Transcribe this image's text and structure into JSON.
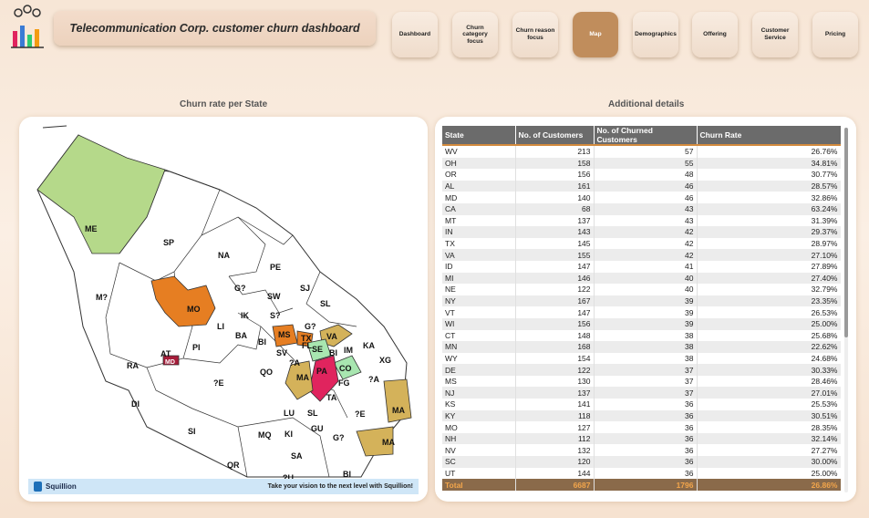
{
  "header": {
    "title": "Telecommunication Corp. customer churn dashboard"
  },
  "nav": [
    {
      "label": "Dashboard",
      "active": false
    },
    {
      "label": "Churn category focus",
      "active": false
    },
    {
      "label": "Churn reason focus",
      "active": false
    },
    {
      "label": "Map",
      "active": true
    },
    {
      "label": "Demographics",
      "active": false
    },
    {
      "label": "Offering",
      "active": false
    },
    {
      "label": "Customer Service",
      "active": false
    },
    {
      "label": "Pricing",
      "active": false
    }
  ],
  "map": {
    "section_title": "Churn rate per State",
    "regions": [
      "ME",
      "SP",
      "NA",
      "PE",
      "M?",
      "SJ",
      "G?",
      "SW",
      "MO",
      "SL",
      "IK",
      "S?",
      "LI",
      "G?",
      "BA",
      "MS",
      "TX",
      "VA",
      "BI",
      "IM",
      "AT",
      "PI",
      "FL",
      "SE",
      "BI",
      "KA",
      "SV",
      "?A",
      "MD",
      "RA",
      "QO",
      "CO",
      "XG",
      "MA",
      "PA",
      "FG",
      "?A",
      "?E",
      "DI",
      "TA",
      "LU",
      "SL",
      "MA",
      "?E",
      "SI",
      "GU",
      "MQ",
      "KI",
      "G?",
      "MA",
      "SA",
      "QR",
      "?U",
      "BI"
    ],
    "footer_brand": "Squillion",
    "footer_tagline": "Take your vision to the next level with Squillion!"
  },
  "table": {
    "section_title": "Additional details",
    "columns": [
      "State",
      "No. of Customers",
      "No. of Churned Customers",
      "Churn Rate"
    ],
    "rows": [
      [
        "WV",
        "213",
        "57",
        "26.76%"
      ],
      [
        "OH",
        "158",
        "55",
        "34.81%"
      ],
      [
        "OR",
        "156",
        "48",
        "30.77%"
      ],
      [
        "AL",
        "161",
        "46",
        "28.57%"
      ],
      [
        "MD",
        "140",
        "46",
        "32.86%"
      ],
      [
        "CA",
        "68",
        "43",
        "63.24%"
      ],
      [
        "MT",
        "137",
        "43",
        "31.39%"
      ],
      [
        "IN",
        "143",
        "42",
        "29.37%"
      ],
      [
        "TX",
        "145",
        "42",
        "28.97%"
      ],
      [
        "VA",
        "155",
        "42",
        "27.10%"
      ],
      [
        "ID",
        "147",
        "41",
        "27.89%"
      ],
      [
        "MI",
        "146",
        "40",
        "27.40%"
      ],
      [
        "NE",
        "122",
        "40",
        "32.79%"
      ],
      [
        "NY",
        "167",
        "39",
        "23.35%"
      ],
      [
        "VT",
        "147",
        "39",
        "26.53%"
      ],
      [
        "WI",
        "156",
        "39",
        "25.00%"
      ],
      [
        "CT",
        "148",
        "38",
        "25.68%"
      ],
      [
        "MN",
        "168",
        "38",
        "22.62%"
      ],
      [
        "WY",
        "154",
        "38",
        "24.68%"
      ],
      [
        "DE",
        "122",
        "37",
        "30.33%"
      ],
      [
        "MS",
        "130",
        "37",
        "28.46%"
      ],
      [
        "NJ",
        "137",
        "37",
        "27.01%"
      ],
      [
        "KS",
        "141",
        "36",
        "25.53%"
      ],
      [
        "KY",
        "118",
        "36",
        "30.51%"
      ],
      [
        "MO",
        "127",
        "36",
        "28.35%"
      ],
      [
        "NH",
        "112",
        "36",
        "32.14%"
      ],
      [
        "NV",
        "132",
        "36",
        "27.27%"
      ],
      [
        "SC",
        "120",
        "36",
        "30.00%"
      ],
      [
        "UT",
        "144",
        "36",
        "25.00%"
      ]
    ],
    "total": [
      "Total",
      "6687",
      "1796",
      "26.86%"
    ]
  },
  "colors": {
    "accent": "#c08d5c",
    "header_gray": "#6b6b6b",
    "total_text": "#f2a54b",
    "map_green": "#b5d98a",
    "map_orange": "#e67e22",
    "map_gold": "#d4b25a",
    "map_red": "#e0245e",
    "map_light_green": "#a8e6b0"
  }
}
